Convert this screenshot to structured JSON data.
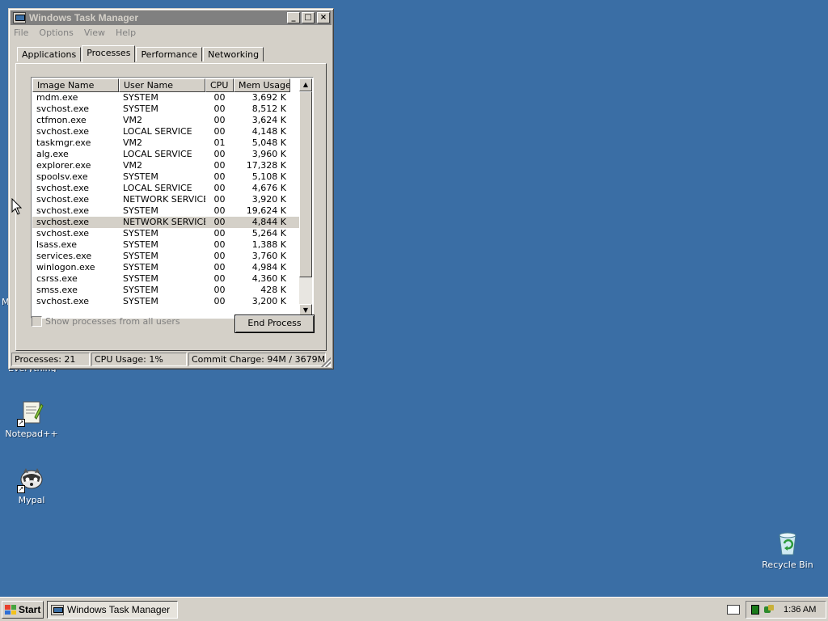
{
  "window": {
    "title": "Windows Task Manager",
    "buttons": {
      "minimize": "_",
      "maximize": "□",
      "close": "×"
    }
  },
  "menu": [
    "File",
    "Options",
    "View",
    "Help"
  ],
  "tabs": [
    "Applications",
    "Processes",
    "Performance",
    "Networking"
  ],
  "active_tab": "Processes",
  "columns": [
    "Image Name",
    "User Name",
    "CPU",
    "Mem Usage"
  ],
  "processes": [
    {
      "image": "mdm.exe",
      "user": "SYSTEM",
      "cpu": "00",
      "mem": "3,692 K"
    },
    {
      "image": "svchost.exe",
      "user": "SYSTEM",
      "cpu": "00",
      "mem": "8,512 K"
    },
    {
      "image": "ctfmon.exe",
      "user": "VM2",
      "cpu": "00",
      "mem": "3,624 K"
    },
    {
      "image": "svchost.exe",
      "user": "LOCAL SERVICE",
      "cpu": "00",
      "mem": "4,148 K"
    },
    {
      "image": "taskmgr.exe",
      "user": "VM2",
      "cpu": "01",
      "mem": "5,048 K"
    },
    {
      "image": "alg.exe",
      "user": "LOCAL SERVICE",
      "cpu": "00",
      "mem": "3,960 K"
    },
    {
      "image": "explorer.exe",
      "user": "VM2",
      "cpu": "00",
      "mem": "17,328 K"
    },
    {
      "image": "spoolsv.exe",
      "user": "SYSTEM",
      "cpu": "00",
      "mem": "5,108 K"
    },
    {
      "image": "svchost.exe",
      "user": "LOCAL SERVICE",
      "cpu": "00",
      "mem": "4,676 K"
    },
    {
      "image": "svchost.exe",
      "user": "NETWORK SERVICE",
      "cpu": "00",
      "mem": "3,920 K"
    },
    {
      "image": "svchost.exe",
      "user": "SYSTEM",
      "cpu": "00",
      "mem": "19,624 K"
    },
    {
      "image": "svchost.exe",
      "user": "NETWORK SERVICE",
      "cpu": "00",
      "mem": "4,844 K"
    },
    {
      "image": "svchost.exe",
      "user": "SYSTEM",
      "cpu": "00",
      "mem": "5,264 K"
    },
    {
      "image": "lsass.exe",
      "user": "SYSTEM",
      "cpu": "00",
      "mem": "1,388 K"
    },
    {
      "image": "services.exe",
      "user": "SYSTEM",
      "cpu": "00",
      "mem": "3,760 K"
    },
    {
      "image": "winlogon.exe",
      "user": "SYSTEM",
      "cpu": "00",
      "mem": "4,984 K"
    },
    {
      "image": "csrss.exe",
      "user": "SYSTEM",
      "cpu": "00",
      "mem": "4,360 K"
    },
    {
      "image": "smss.exe",
      "user": "SYSTEM",
      "cpu": "00",
      "mem": "428 K"
    },
    {
      "image": "svchost.exe",
      "user": "SYSTEM",
      "cpu": "00",
      "mem": "3,200 K"
    }
  ],
  "selected_row": 11,
  "show_all_label": "Show processes from all users",
  "end_process_label": "End Process",
  "status": {
    "processes": "Processes: 21",
    "cpu": "CPU Usage: 1%",
    "commit": "Commit Charge: 94M / 3679M"
  },
  "desktop": {
    "partial_label_1": "Everything",
    "partial_label_2": "M",
    "icons": [
      {
        "label": "Notepad++",
        "icon": "notepadpp-icon"
      },
      {
        "label": "Mypal",
        "icon": "mypal-icon"
      },
      {
        "label": "Recycle Bin",
        "icon": "recycle-bin-icon"
      }
    ]
  },
  "taskbar": {
    "start_label": "Start",
    "task_label": "Windows Task Manager",
    "clock": "1:36 AM"
  },
  "colors": {
    "desktop": "#3a6ea5",
    "face": "#d4d0c8",
    "inactive_title": "#808080"
  }
}
